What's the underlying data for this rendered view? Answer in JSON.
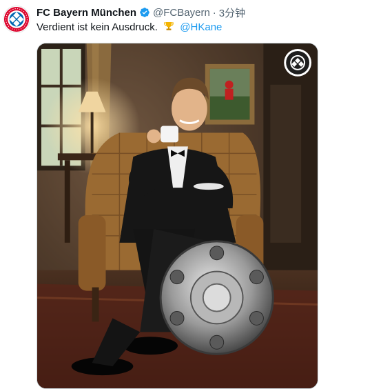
{
  "tweet": {
    "author_name": "FC Bayern München",
    "handle": "@FCBayern",
    "separator": "·",
    "time": "3分钟",
    "text_main": "Verdient ist kein Ausdruck.",
    "mention": "@HKane"
  },
  "avatar": {
    "logo_text": "FC BAYERN MÜNCHEN"
  },
  "media": {
    "watermark_logo_text": "FC BAYERN MÜNCHEN"
  },
  "colors": {
    "bayern_red": "#dc052d",
    "bayern_blue": "#0066b2",
    "link": "#1d9bf0",
    "verified": "#1d9bf0",
    "muted": "#536471"
  },
  "icons": {
    "avatar": "fc-bayern-logo",
    "verified": "verified-badge-icon",
    "emoji": "trophy-emoji-icon",
    "watermark": "fc-bayern-logo"
  }
}
